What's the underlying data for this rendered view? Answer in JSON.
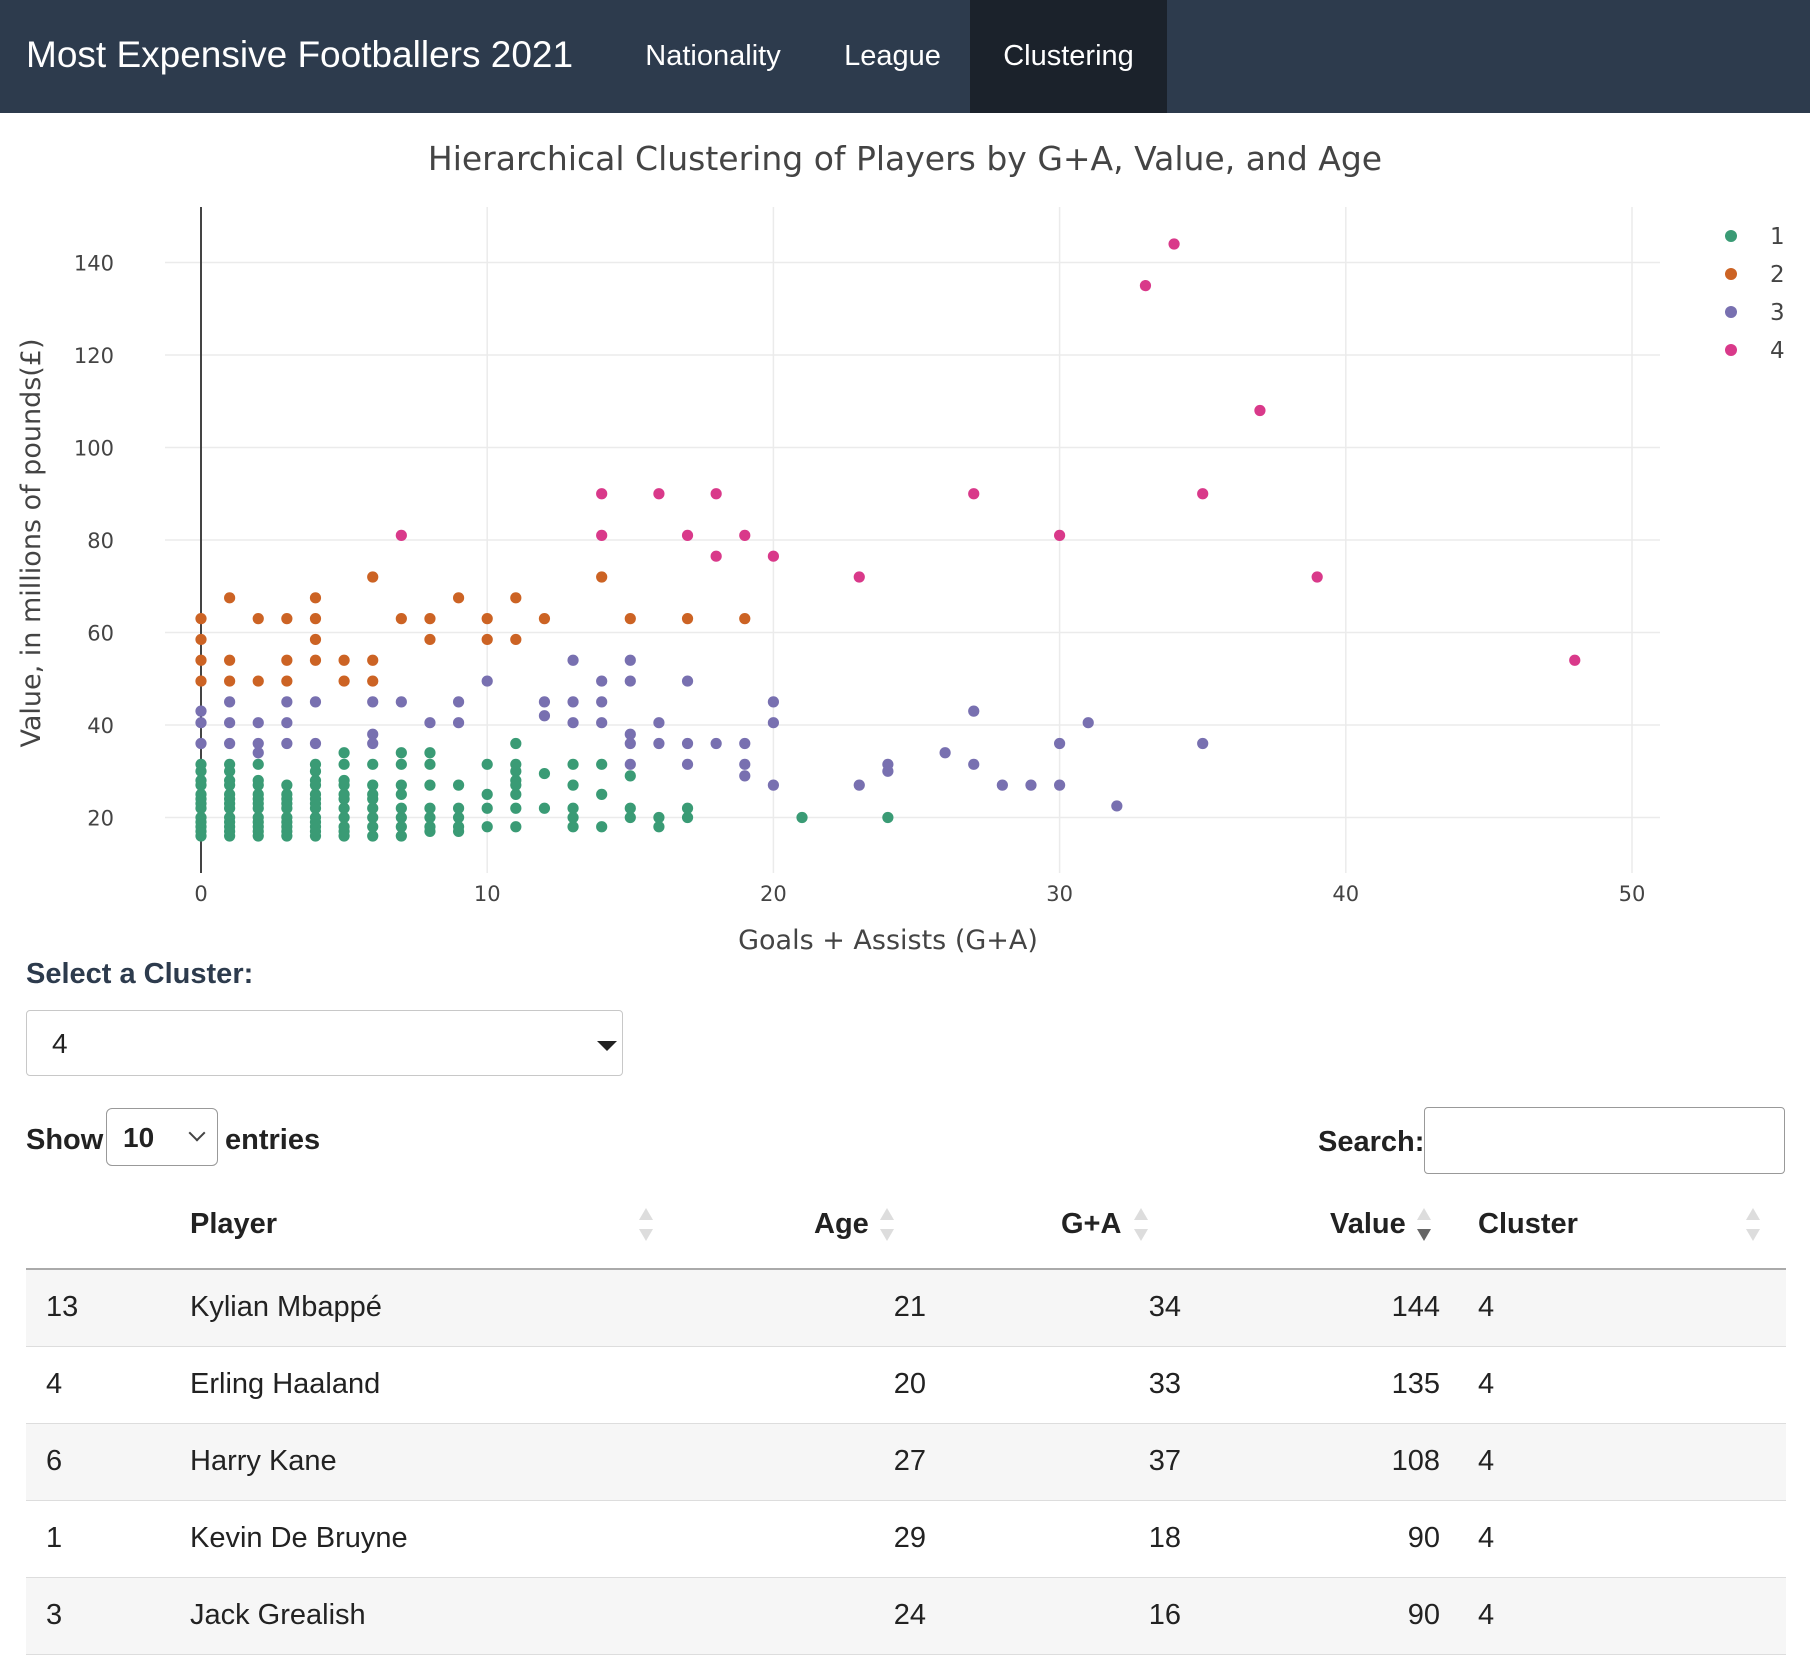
{
  "navbar": {
    "brand": "Most Expensive Footballers 2021",
    "tabs": [
      "Nationality",
      "League",
      "Clustering"
    ],
    "active_tab": "Clustering"
  },
  "colors": {
    "navbar_bg": "#2d3b4d",
    "active_tab_bg": "#1b222b",
    "cluster_1": "#3a9b75",
    "cluster_2": "#cc6324",
    "cluster_3": "#7870b0",
    "cluster_4": "#d9398a"
  },
  "chart_data": {
    "type": "scatter",
    "title": "Hierarchical Clustering of Players by G+A, Value, and Age",
    "xlabel": "Goals + Assists (G+A)",
    "ylabel": "Value, in millions of pounds(£)",
    "xlim": [
      -1.5,
      51.5
    ],
    "ylim": [
      8,
      152
    ],
    "xticks": [
      0,
      10,
      20,
      30,
      40,
      50
    ],
    "yticks": [
      20,
      40,
      60,
      80,
      100,
      120,
      140
    ],
    "grid": true,
    "legend_position": "top-right",
    "series": [
      {
        "name": "1",
        "color": "#3a9b75",
        "points": [
          [
            0,
            16
          ],
          [
            0,
            17
          ],
          [
            0,
            18
          ],
          [
            0,
            19
          ],
          [
            0,
            20
          ],
          [
            0,
            22
          ],
          [
            0,
            23
          ],
          [
            0,
            24
          ],
          [
            0,
            25
          ],
          [
            0,
            27
          ],
          [
            0,
            28
          ],
          [
            0,
            30
          ],
          [
            0,
            31.5
          ],
          [
            1,
            16
          ],
          [
            1,
            17
          ],
          [
            1,
            18
          ],
          [
            1,
            19
          ],
          [
            1,
            20
          ],
          [
            1,
            22
          ],
          [
            1,
            23
          ],
          [
            1,
            24
          ],
          [
            1,
            25
          ],
          [
            1,
            27
          ],
          [
            1,
            28
          ],
          [
            1,
            30
          ],
          [
            1,
            31.5
          ],
          [
            2,
            16
          ],
          [
            2,
            17
          ],
          [
            2,
            18
          ],
          [
            2,
            19
          ],
          [
            2,
            20
          ],
          [
            2,
            22
          ],
          [
            2,
            23
          ],
          [
            2,
            24
          ],
          [
            2,
            25
          ],
          [
            2,
            27
          ],
          [
            2,
            28
          ],
          [
            2,
            31.5
          ],
          [
            3,
            16
          ],
          [
            3,
            17
          ],
          [
            3,
            18
          ],
          [
            3,
            19
          ],
          [
            3,
            20
          ],
          [
            3,
            22
          ],
          [
            3,
            23
          ],
          [
            3,
            24
          ],
          [
            3,
            25
          ],
          [
            3,
            27
          ],
          [
            4,
            16
          ],
          [
            4,
            17
          ],
          [
            4,
            18
          ],
          [
            4,
            19
          ],
          [
            4,
            20
          ],
          [
            4,
            22
          ],
          [
            4,
            23
          ],
          [
            4,
            24
          ],
          [
            4,
            25
          ],
          [
            4,
            27
          ],
          [
            4,
            28
          ],
          [
            4,
            30
          ],
          [
            4,
            31.5
          ],
          [
            5,
            16
          ],
          [
            5,
            17
          ],
          [
            5,
            18
          ],
          [
            5,
            20
          ],
          [
            5,
            22
          ],
          [
            5,
            24
          ],
          [
            5,
            25
          ],
          [
            5,
            27
          ],
          [
            5,
            28
          ],
          [
            5,
            31.5
          ],
          [
            5,
            34
          ],
          [
            6,
            16
          ],
          [
            6,
            18
          ],
          [
            6,
            20
          ],
          [
            6,
            22
          ],
          [
            6,
            24
          ],
          [
            6,
            25
          ],
          [
            6,
            27
          ],
          [
            6,
            31.5
          ],
          [
            7,
            16
          ],
          [
            7,
            18
          ],
          [
            7,
            20
          ],
          [
            7,
            22
          ],
          [
            7,
            25
          ],
          [
            7,
            27
          ],
          [
            7,
            31.5
          ],
          [
            7,
            34
          ],
          [
            8,
            17
          ],
          [
            8,
            18
          ],
          [
            8,
            20
          ],
          [
            8,
            22
          ],
          [
            8,
            27
          ],
          [
            8,
            31.5
          ],
          [
            8,
            34
          ],
          [
            9,
            17
          ],
          [
            9,
            18
          ],
          [
            9,
            20
          ],
          [
            9,
            22
          ],
          [
            9,
            27
          ],
          [
            10,
            18
          ],
          [
            10,
            22
          ],
          [
            10,
            25
          ],
          [
            10,
            31.5
          ],
          [
            11,
            18
          ],
          [
            11,
            22
          ],
          [
            11,
            25
          ],
          [
            11,
            27
          ],
          [
            11,
            28
          ],
          [
            11,
            30
          ],
          [
            11,
            31.5
          ],
          [
            11,
            36
          ],
          [
            12,
            22
          ],
          [
            12,
            29.5
          ],
          [
            13,
            18
          ],
          [
            13,
            20
          ],
          [
            13,
            22
          ],
          [
            13,
            27
          ],
          [
            13,
            31.5
          ],
          [
            14,
            18
          ],
          [
            14,
            25
          ],
          [
            14,
            31.5
          ],
          [
            15,
            20
          ],
          [
            15,
            22
          ],
          [
            15,
            29
          ],
          [
            16,
            18
          ],
          [
            16,
            20
          ],
          [
            17,
            20
          ],
          [
            17,
            22
          ],
          [
            21,
            20
          ],
          [
            24,
            20
          ]
        ]
      },
      {
        "name": "2",
        "color": "#cc6324",
        "points": [
          [
            0,
            49.5
          ],
          [
            0,
            54
          ],
          [
            0,
            58.5
          ],
          [
            0,
            63
          ],
          [
            1,
            49.5
          ],
          [
            1,
            54
          ],
          [
            1,
            67.5
          ],
          [
            2,
            49.5
          ],
          [
            2,
            63
          ],
          [
            3,
            49.5
          ],
          [
            3,
            54
          ],
          [
            3,
            63
          ],
          [
            4,
            54
          ],
          [
            4,
            58.5
          ],
          [
            4,
            63
          ],
          [
            4,
            67.5
          ],
          [
            5,
            49.5
          ],
          [
            5,
            54
          ],
          [
            6,
            49.5
          ],
          [
            6,
            54
          ],
          [
            6,
            72
          ],
          [
            7,
            63
          ],
          [
            8,
            58.5
          ],
          [
            8,
            63
          ],
          [
            9,
            67.5
          ],
          [
            10,
            58.5
          ],
          [
            10,
            63
          ],
          [
            11,
            58.5
          ],
          [
            11,
            67.5
          ],
          [
            12,
            63
          ],
          [
            14,
            72
          ],
          [
            15,
            63
          ],
          [
            17,
            63
          ],
          [
            19,
            63
          ]
        ]
      },
      {
        "name": "3",
        "color": "#7870b0",
        "points": [
          [
            0,
            36
          ],
          [
            0,
            40.5
          ],
          [
            0,
            43
          ],
          [
            1,
            36
          ],
          [
            1,
            40.5
          ],
          [
            1,
            45
          ],
          [
            2,
            34
          ],
          [
            2,
            36
          ],
          [
            2,
            40.5
          ],
          [
            3,
            36
          ],
          [
            3,
            40.5
          ],
          [
            3,
            45
          ],
          [
            4,
            36
          ],
          [
            4,
            45
          ],
          [
            6,
            36
          ],
          [
            6,
            38
          ],
          [
            6,
            45
          ],
          [
            7,
            45
          ],
          [
            8,
            40.5
          ],
          [
            9,
            40.5
          ],
          [
            9,
            45
          ],
          [
            10,
            49.5
          ],
          [
            12,
            42
          ],
          [
            12,
            45
          ],
          [
            13,
            40.5
          ],
          [
            13,
            45
          ],
          [
            13,
            54
          ],
          [
            14,
            40.5
          ],
          [
            14,
            45
          ],
          [
            14,
            49.5
          ],
          [
            15,
            31.5
          ],
          [
            15,
            36
          ],
          [
            15,
            38
          ],
          [
            15,
            49.5
          ],
          [
            15,
            54
          ],
          [
            16,
            36
          ],
          [
            16,
            40.5
          ],
          [
            17,
            31.5
          ],
          [
            17,
            36
          ],
          [
            17,
            49.5
          ],
          [
            18,
            36
          ],
          [
            19,
            29
          ],
          [
            19,
            31.5
          ],
          [
            19,
            36
          ],
          [
            20,
            27
          ],
          [
            20,
            40.5
          ],
          [
            20,
            45
          ],
          [
            23,
            27
          ],
          [
            24,
            30
          ],
          [
            24,
            31.5
          ],
          [
            26,
            34
          ],
          [
            27,
            31.5
          ],
          [
            27,
            43
          ],
          [
            28,
            27
          ],
          [
            29,
            27
          ],
          [
            30,
            27
          ],
          [
            30,
            36
          ],
          [
            31,
            40.5
          ],
          [
            32,
            22.5
          ],
          [
            35,
            36
          ]
        ]
      },
      {
        "name": "4",
        "color": "#d9398a",
        "points": [
          [
            7,
            81
          ],
          [
            14,
            81
          ],
          [
            14,
            90
          ],
          [
            16,
            90
          ],
          [
            17,
            81
          ],
          [
            18,
            76.5
          ],
          [
            18,
            90
          ],
          [
            19,
            81
          ],
          [
            20,
            76.5
          ],
          [
            23,
            72
          ],
          [
            27,
            90
          ],
          [
            30,
            81
          ],
          [
            33,
            135
          ],
          [
            34,
            144
          ],
          [
            35,
            90
          ],
          [
            37,
            108
          ],
          [
            39,
            72
          ],
          [
            48,
            54
          ]
        ]
      }
    ]
  },
  "cluster_selector": {
    "label": "Select a Cluster:",
    "selected": "4"
  },
  "table_controls": {
    "show_label": "Show",
    "entries_value": "10",
    "entries_label": "entries",
    "search_label": "Search:",
    "search_value": ""
  },
  "table": {
    "headers": {
      "index": "",
      "player": "Player",
      "age": "Age",
      "ga": "G+A",
      "value": "Value",
      "cluster": "Cluster"
    },
    "rows": [
      {
        "index": "13",
        "player": "Kylian Mbappé",
        "age": "21",
        "ga": "34",
        "value": "144",
        "cluster": "4"
      },
      {
        "index": "4",
        "player": "Erling Haaland",
        "age": "20",
        "ga": "33",
        "value": "135",
        "cluster": "4"
      },
      {
        "index": "6",
        "player": "Harry Kane",
        "age": "27",
        "ga": "37",
        "value": "108",
        "cluster": "4"
      },
      {
        "index": "1",
        "player": "Kevin De Bruyne",
        "age": "29",
        "ga": "18",
        "value": "90",
        "cluster": "4"
      },
      {
        "index": "3",
        "player": "Jack Grealish",
        "age": "24",
        "ga": "16",
        "value": "90",
        "cluster": "4"
      }
    ]
  }
}
